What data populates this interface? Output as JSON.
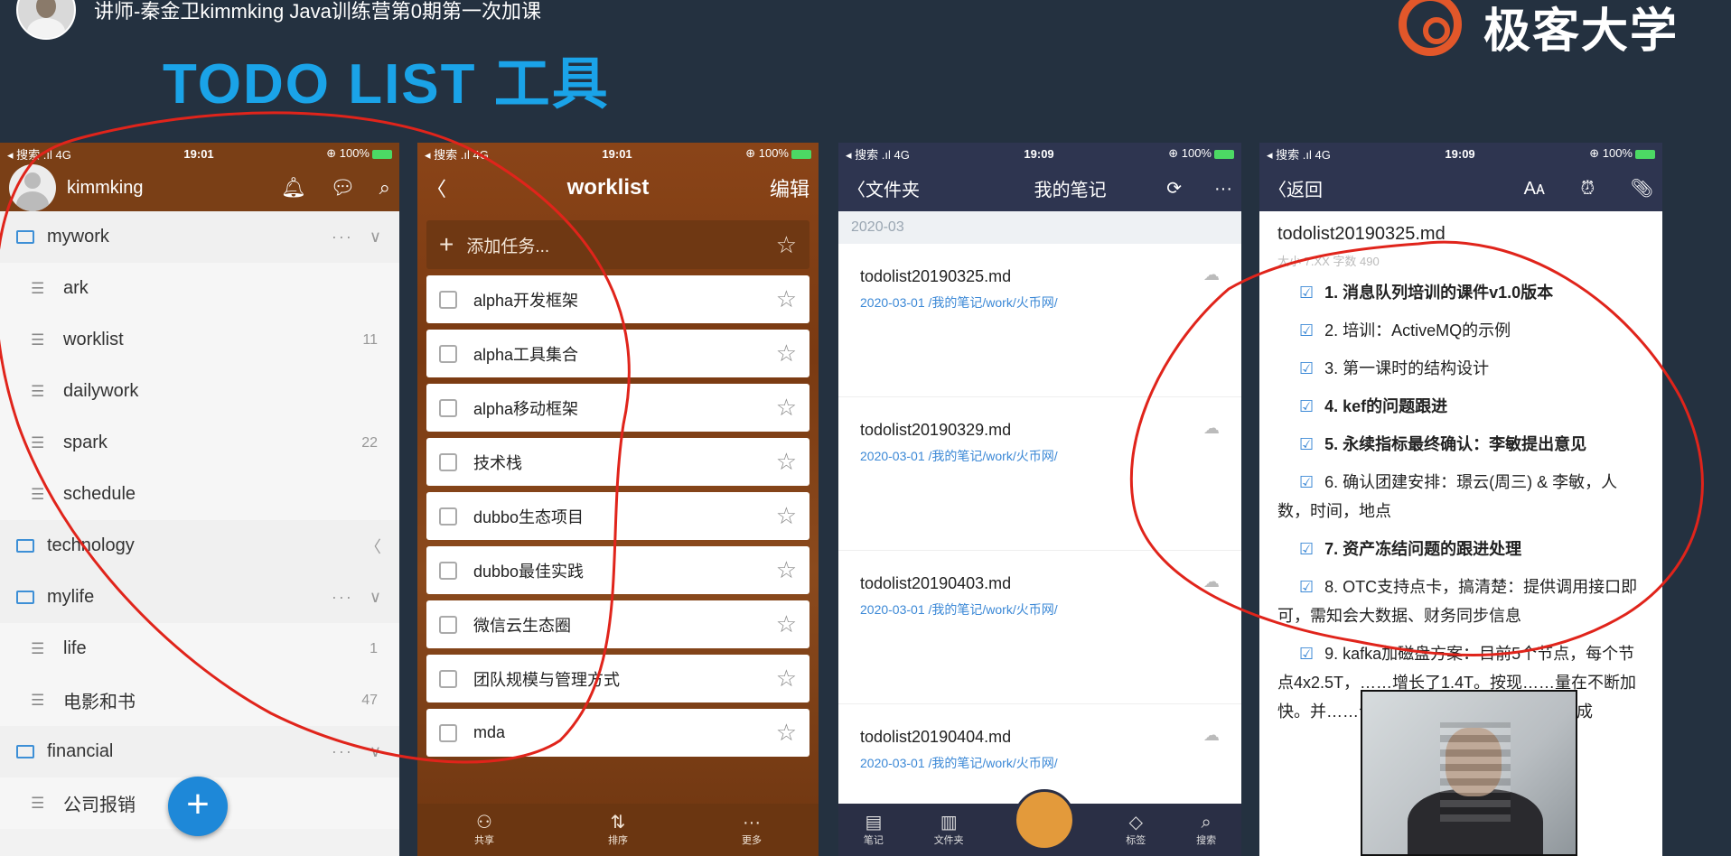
{
  "header": {
    "lecturer_title": "讲师-秦金卫kimmking Java训练营第0期第一次加课",
    "logo_text": "极客大学",
    "slide_title": "TODO LIST 工具"
  },
  "phones": {
    "p1": {
      "status": {
        "left": "◂ 搜索 .ıl 4G",
        "time": "19:01",
        "right": "⊕ 100%"
      },
      "user": "kimmking",
      "tree": [
        {
          "type": "folder",
          "label": "mywork",
          "acts": "···",
          "chev": "∨"
        },
        {
          "type": "item",
          "label": "ark",
          "count": ""
        },
        {
          "type": "item",
          "label": "worklist",
          "count": "11"
        },
        {
          "type": "item",
          "label": "dailywork",
          "count": ""
        },
        {
          "type": "item",
          "label": "spark",
          "count": "22"
        },
        {
          "type": "item",
          "label": "schedule",
          "count": ""
        },
        {
          "type": "folder",
          "label": "technology",
          "acts": "",
          "chev": "〈"
        },
        {
          "type": "folder",
          "label": "mylife",
          "acts": "···",
          "chev": "∨"
        },
        {
          "type": "item",
          "label": "life",
          "count": "1"
        },
        {
          "type": "item",
          "label": "电影和书",
          "count": "47"
        },
        {
          "type": "folder",
          "label": "financial",
          "acts": "···",
          "chev": "∨"
        },
        {
          "type": "item",
          "label": "公司报销",
          "count": ""
        }
      ]
    },
    "p2": {
      "status": {
        "left": "◂ 搜索 .ıl 4G",
        "time": "19:01",
        "right": "⊕ 100%"
      },
      "back": "〈",
      "title": "worklist",
      "edit": "编辑",
      "add_task": "添加任务...",
      "tasks": [
        "alpha开发框架",
        "alpha工具集合",
        "alpha移动框架",
        "技术栈",
        "dubbo生态项目",
        "dubbo最佳实践",
        "微信云生态圈",
        "团队规模与管理方式",
        "mda"
      ],
      "tabs": [
        {
          "icon": "⚇",
          "label": "共享"
        },
        {
          "icon": "⇅",
          "label": "排序"
        },
        {
          "icon": "···",
          "label": "更多"
        }
      ]
    },
    "p3": {
      "status": {
        "left": "◂ 搜索 .ıl 4G",
        "time": "19:09",
        "right": "⊕ 100%"
      },
      "back": "〈文件夹",
      "title": "我的笔记",
      "section": "2020-03",
      "notes": [
        {
          "title": "todolist20190325.md",
          "path": "2020-03-01 /我的笔记/work/火币网/"
        },
        {
          "title": "todolist20190329.md",
          "path": "2020-03-01 /我的笔记/work/火币网/"
        },
        {
          "title": "todolist20190403.md",
          "path": "2020-03-01 /我的笔记/work/火币网/"
        },
        {
          "title": "todolist20190404.md",
          "path": "2020-03-01 /我的笔记/work/火币网/"
        }
      ],
      "tabs": [
        "笔记",
        "文件夹",
        "",
        "标签",
        "搜索"
      ]
    },
    "p4": {
      "status": {
        "left": "◂ 搜索 .ıl 4G",
        "time": "19:09",
        "right": "⊕ 100%"
      },
      "back": "〈返回",
      "doc_title": "todolist20190325.md",
      "doc_meta": "大小 7.XX   字数 490",
      "items": [
        {
          "text": "1. 消息队列培训的课件v1.0版本",
          "bold": true
        },
        {
          "text": "2. 培训：ActiveMQ的示例",
          "bold": false
        },
        {
          "text": "3. 第一课时的结构设计",
          "bold": false
        },
        {
          "text": "4. kef的问题跟进",
          "bold": true
        },
        {
          "text": "5. 永续指标最终确认：李敏提出意见",
          "bold": true
        },
        {
          "text": "6. 确认团建安排：璟云(周三) & 李敏，人数，时间，地点",
          "bold": false
        },
        {
          "text": "7. 资产冻结问题的跟进处理",
          "bold": true
        },
        {
          "text": "8. OTC支持点卡，搞清楚：提供调用接口即可，需知会大数据、财务同步信息",
          "bold": false
        },
        {
          "text": "9. kafka加磁盘方案：目前5个节点，每个节点4x2.5T，……增长了1.4T。按现……量在不断加快。并……合定序kafka改造，……量。从成",
          "bold": false
        }
      ]
    }
  },
  "colors": {
    "accent_blue": "#1aa3e8",
    "annotation_red": "#e0241b",
    "logo_orange": "#e2572a"
  }
}
